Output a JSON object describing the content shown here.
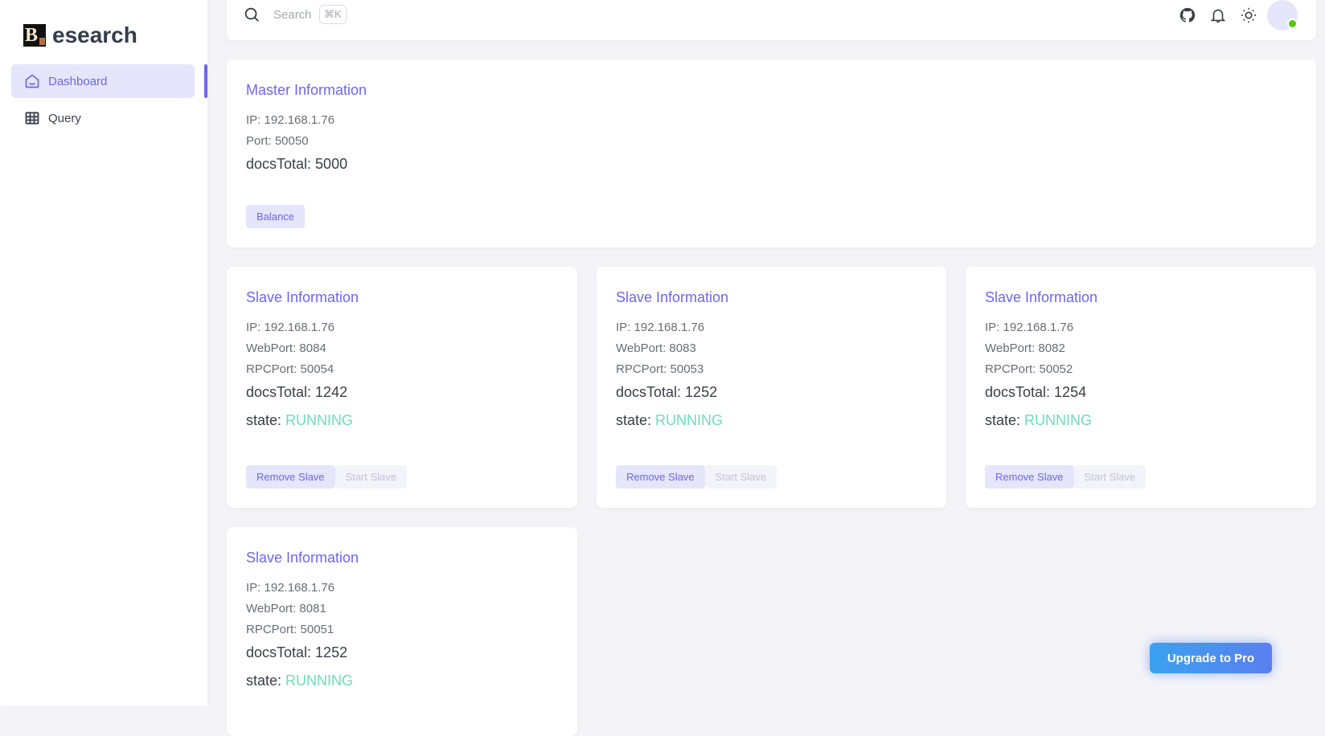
{
  "app": {
    "name": "esearch",
    "logo_text": "B"
  },
  "sidebar": {
    "items": [
      {
        "label": "Dashboard",
        "icon": "home-icon",
        "active": true
      },
      {
        "label": "Query",
        "icon": "table-icon",
        "active": false
      }
    ]
  },
  "header": {
    "search_placeholder": "Search",
    "shortcut": "⌘K",
    "icons": [
      "search-icon",
      "github-icon",
      "bell-icon",
      "sun-icon",
      "avatar"
    ],
    "online_color": "#56ca00"
  },
  "master": {
    "title": "Master Information",
    "ip": "IP: 192.168.1.76",
    "port": "Port: 50050",
    "docs": "docsTotal: 5000",
    "button": "Balance"
  },
  "slaves": [
    {
      "title": "Slave Information",
      "ip": "IP: 192.168.1.76",
      "web": "WebPort: 8084",
      "rpc": "RPCPort: 50054",
      "docs": "docsTotal: 1242",
      "state_label": "state: ",
      "state": "RUNNING",
      "remove": "Remove Slave",
      "start": "Start Slave"
    },
    {
      "title": "Slave Information",
      "ip": "IP: 192.168.1.76",
      "web": "WebPort: 8083",
      "rpc": "RPCPort: 50053",
      "docs": "docsTotal: 1252",
      "state_label": "state: ",
      "state": "RUNNING",
      "remove": "Remove Slave",
      "start": "Start Slave"
    },
    {
      "title": "Slave Information",
      "ip": "IP: 192.168.1.76",
      "web": "WebPort: 8082",
      "rpc": "RPCPort: 50052",
      "docs": "docsTotal: 1254",
      "state_label": "state: ",
      "state": "RUNNING",
      "remove": "Remove Slave",
      "start": "Start Slave"
    },
    {
      "title": "Slave Information",
      "ip": "IP: 192.168.1.76",
      "web": "WebPort: 8081",
      "rpc": "RPCPort: 50051",
      "docs": "docsTotal: 1252",
      "state_label": "state: ",
      "state": "RUNNING",
      "remove": "Remove Slave",
      "start": "Start Slave"
    }
  ],
  "upgrade": "Upgrade to Pro",
  "colors": {
    "accent": "#6c67f0",
    "running": "#6fdcb9"
  }
}
